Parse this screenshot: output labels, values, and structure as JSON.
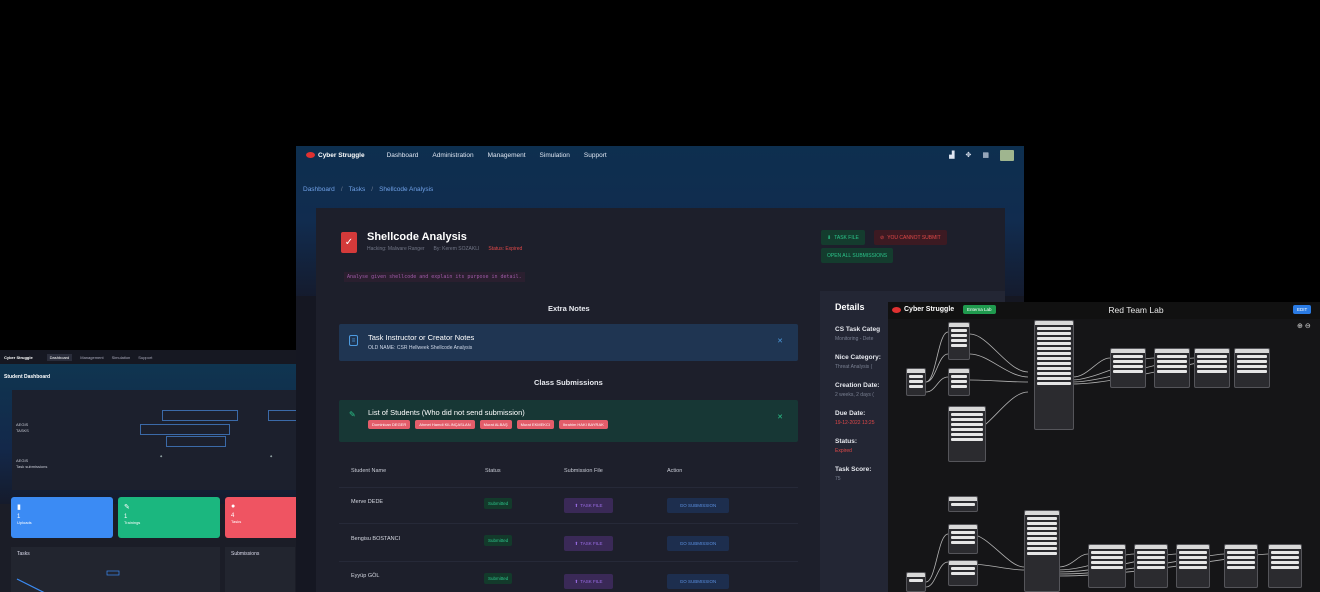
{
  "left_window": {
    "nav": {
      "logo": "Cyber Struggle",
      "items": [
        "Dashboard",
        "Management",
        "Simulation",
        "Support"
      ]
    },
    "title": "Student Dashboard",
    "gantt_rows": [
      "AEGIS",
      "TASKS",
      "AEGIS",
      "Task submissions"
    ],
    "cards": [
      {
        "icon": "bookmark-icon",
        "num": "1",
        "label": "Uploads",
        "color": "#3b8bf4"
      },
      {
        "icon": "pencil-icon",
        "num": "1",
        "label": "Trainings",
        "color": "#1bb77f"
      },
      {
        "icon": "user-icon",
        "num": "4",
        "label": "Tasks",
        "color": "#ef5462"
      }
    ],
    "panel_tasks": "Tasks",
    "panel_submissions": "Submissions"
  },
  "main": {
    "nav": {
      "logo": "Cyber Struggle",
      "links": [
        "Dashboard",
        "Administration",
        "Management",
        "Simulation",
        "Support"
      ]
    },
    "breadcrumbs": [
      "Dashboard",
      "Tasks",
      "Shellcode Analysis"
    ],
    "task": {
      "title": "Shellcode Analysis",
      "track": "Hacking: Malware Ranger",
      "author": "By: Kerem SOZAKLI",
      "status": "Status: Expired",
      "description": "Analyse given shellcode and explain its purpose in detail."
    },
    "buttons": {
      "task_file": "TASK FILE",
      "cannot_submit": "YOU CANNOT SUBMIT",
      "open_all": "OPEN ALL SUBMISSIONS"
    },
    "extra_notes_title": "Extra Notes",
    "note": {
      "title": "Task Instructor or Creator Notes",
      "text": "OLD NAME: CSR Hellweek Shellcode Analysis"
    },
    "class_submissions_title": "Class Submissions",
    "not_sent": {
      "title": "List of Students (Who did not send submission)",
      "students": [
        "Dominican DEGER",
        "Ahmet Hamdi KILINÇASLAN",
        "Murat ALBAŞ",
        "Murat EKMEKCI",
        "Ibrahim HAKI BAYRAK"
      ]
    },
    "table": {
      "headers": [
        "Student Name",
        "Status",
        "Submission File",
        "Action"
      ],
      "rows": [
        {
          "name": "Merve DEDE",
          "status": "Submitted",
          "file": "TASK FILE",
          "action": "GO SUBMISSION"
        },
        {
          "name": "Bengisu BOSTANCI",
          "status": "Submitted",
          "file": "TASK FILE",
          "action": "GO SUBMISSION"
        },
        {
          "name": "Eyyüp GÖL",
          "status": "Submitted",
          "file": "TASK FILE",
          "action": "GO SUBMISSION"
        }
      ]
    },
    "details": {
      "title": "Details",
      "items": [
        {
          "key": "CS Task Categ",
          "value": "Monitoring - Dete",
          "red": false
        },
        {
          "key": "Nice Category:",
          "value": "Threat Analysis (",
          "red": false
        },
        {
          "key": "Creation Date:",
          "value": "2 weeks, 2 days (",
          "red": false
        },
        {
          "key": "Due Date:",
          "value": "19-12-2022 13:25",
          "red": true
        },
        {
          "key": "Status:",
          "value": "Expired",
          "red": true
        },
        {
          "key": "Task Score:",
          "value": "75",
          "red": false
        }
      ]
    }
  },
  "right_window": {
    "logo": "Cyber Struggle",
    "pill": "Enterna Lab",
    "title": "Red Team Lab",
    "edit": "EDIT"
  }
}
